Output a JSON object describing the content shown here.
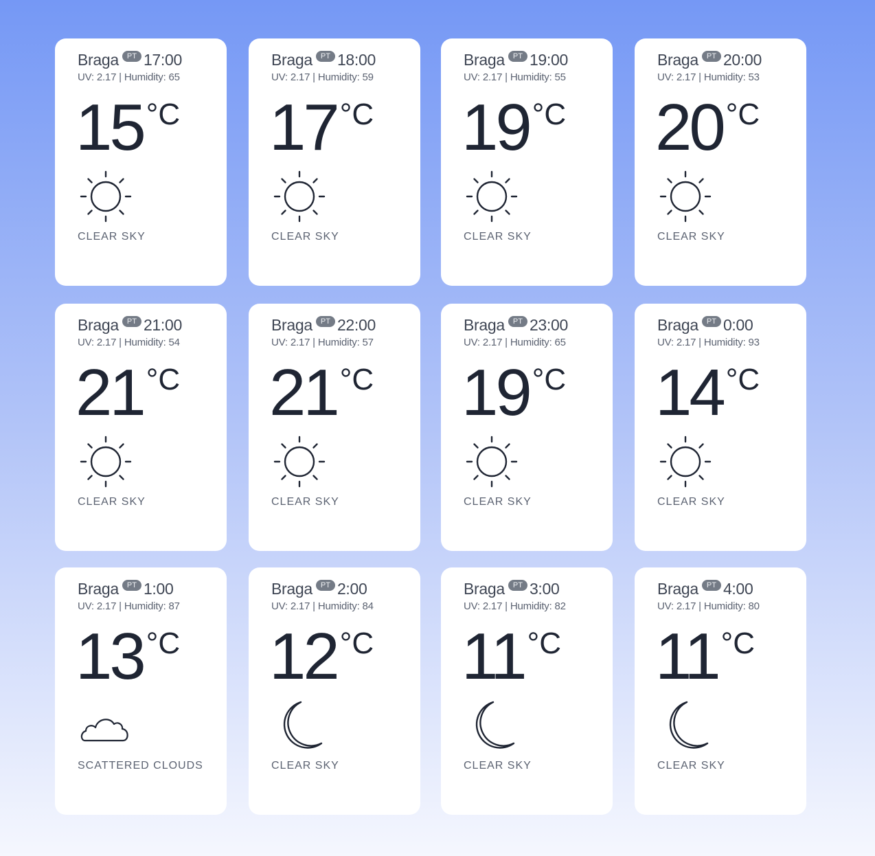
{
  "unit": "°C",
  "cards": [
    {
      "city": "Braga",
      "country": "PT",
      "time": "17:00",
      "meta": "UV: 2.17 | Humidity: 65",
      "temp": "15",
      "icon": "sun-icon",
      "desc": "CLEAR SKY"
    },
    {
      "city": "Braga",
      "country": "PT",
      "time": "18:00",
      "meta": "UV: 2.17 | Humidity: 59",
      "temp": "17",
      "icon": "sun-icon",
      "desc": "CLEAR SKY"
    },
    {
      "city": "Braga",
      "country": "PT",
      "time": "19:00",
      "meta": "UV: 2.17 | Humidity: 55",
      "temp": "19",
      "icon": "sun-icon",
      "desc": "CLEAR SKY"
    },
    {
      "city": "Braga",
      "country": "PT",
      "time": "20:00",
      "meta": "UV: 2.17 | Humidity: 53",
      "temp": "20",
      "icon": "sun-icon",
      "desc": "CLEAR SKY"
    },
    {
      "city": "Braga",
      "country": "PT",
      "time": "21:00",
      "meta": "UV: 2.17 | Humidity: 54",
      "temp": "21",
      "icon": "sun-icon",
      "desc": "CLEAR SKY"
    },
    {
      "city": "Braga",
      "country": "PT",
      "time": "22:00",
      "meta": "UV: 2.17 | Humidity: 57",
      "temp": "21",
      "icon": "sun-icon",
      "desc": "CLEAR SKY"
    },
    {
      "city": "Braga",
      "country": "PT",
      "time": "23:00",
      "meta": "UV: 2.17 | Humidity: 65",
      "temp": "19",
      "icon": "sun-icon",
      "desc": "CLEAR SKY"
    },
    {
      "city": "Braga",
      "country": "PT",
      "time": "0:00",
      "meta": "UV: 2.17 | Humidity: 93",
      "temp": "14",
      "icon": "sun-icon",
      "desc": "CLEAR SKY"
    },
    {
      "city": "Braga",
      "country": "PT",
      "time": "1:00",
      "meta": "UV: 2.17 | Humidity: 87",
      "temp": "13",
      "icon": "cloud-icon",
      "desc": "SCATTERED CLOUDS"
    },
    {
      "city": "Braga",
      "country": "PT",
      "time": "2:00",
      "meta": "UV: 2.17 | Humidity: 84",
      "temp": "12",
      "icon": "moon-icon",
      "desc": "CLEAR SKY"
    },
    {
      "city": "Braga",
      "country": "PT",
      "time": "3:00",
      "meta": "UV: 2.17 | Humidity: 82",
      "temp": "11",
      "icon": "moon-icon",
      "desc": "CLEAR SKY"
    },
    {
      "city": "Braga",
      "country": "PT",
      "time": "4:00",
      "meta": "UV: 2.17 | Humidity: 80",
      "temp": "11",
      "icon": "moon-icon",
      "desc": "CLEAR SKY"
    }
  ]
}
